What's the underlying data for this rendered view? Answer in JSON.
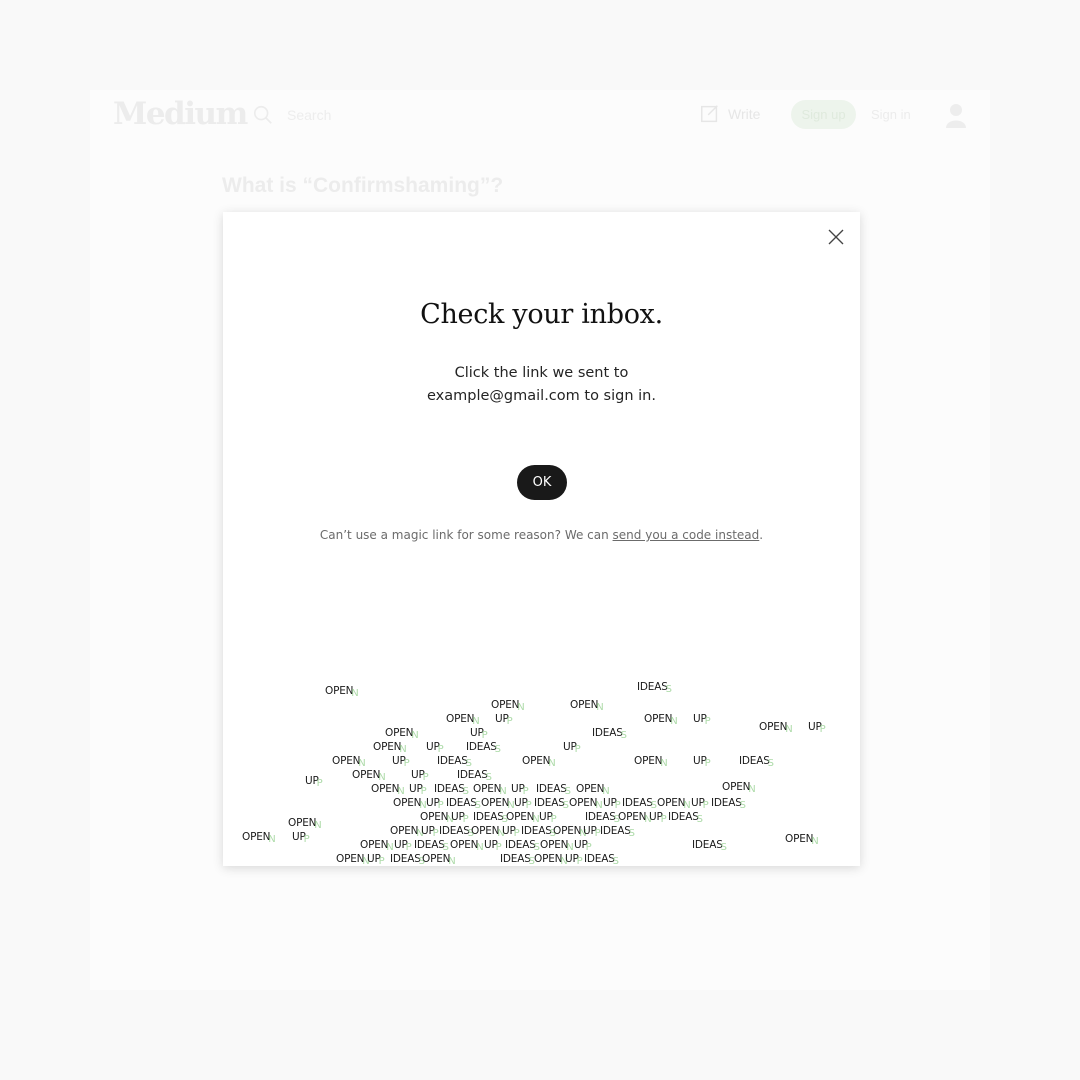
{
  "header": {
    "logo": "Medium",
    "search_placeholder": "Search",
    "write_label": "Write",
    "signup_label": "Sign up",
    "signin_label": "Sign in"
  },
  "article": {
    "title": "What is “Confirmshaming”?"
  },
  "modal": {
    "heading": "Check your inbox.",
    "body_line1": "Click the link we sent to",
    "body_line2": "example@gmail.com to sign in.",
    "ok_label": "OK",
    "alt_prefix": "Can’t use a magic link for some reason? We can ",
    "alt_link": "send you a code instead",
    "alt_suffix": "."
  },
  "illustration": {
    "words": [
      "OPEN",
      "UP",
      "IDEAS"
    ],
    "accent_color": "#9fd49a"
  },
  "colors": {
    "ok_button": "#191919",
    "signup_button": "#edf4ec"
  }
}
